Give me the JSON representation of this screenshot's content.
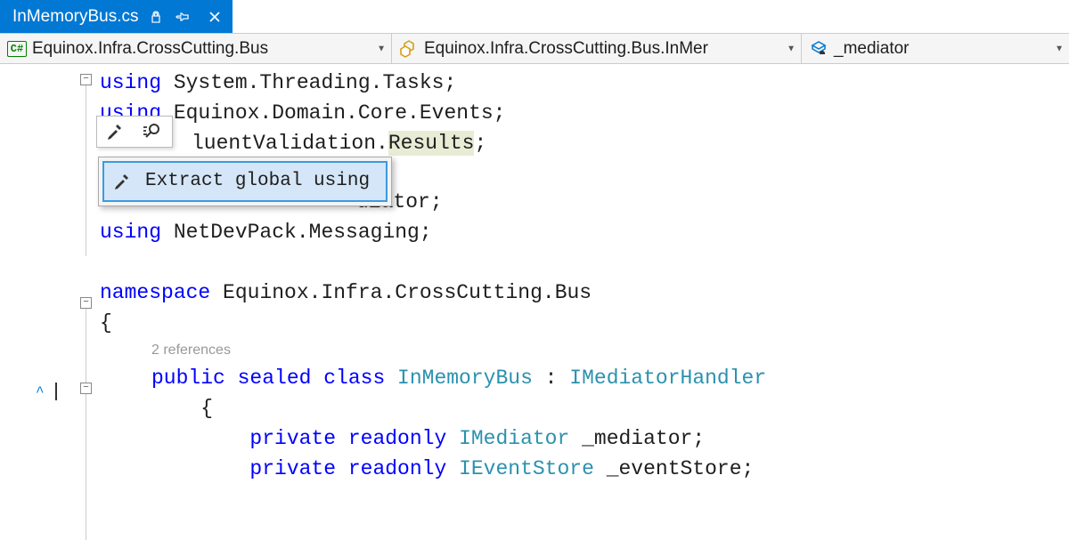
{
  "tab": {
    "title": "InMemoryBus.cs"
  },
  "nav": {
    "namespace": "Equinox.Infra.CrossCutting.Bus",
    "class": "Equinox.Infra.CrossCutting.Bus.InMer",
    "member": "_mediator"
  },
  "smartTag": {
    "action": "Extract global using"
  },
  "code": {
    "line1": {
      "kw": "using",
      "rest": " System.Threading.Tasks;"
    },
    "line2": {
      "kw": "using",
      "rest": " Equinox.Domain.Core.Events;"
    },
    "line3": {
      "pre": "luentValidation.",
      "hl": "Results",
      "post": ";"
    },
    "line4": {
      "rest": "diator;"
    },
    "line5": {
      "kw": "using",
      "rest": " NetDevPack.Messaging;"
    },
    "ns": {
      "kw": "namespace",
      "rest": " Equinox.Infra.CrossCutting.Bus"
    },
    "brace_open": "{",
    "codelens": "2 references",
    "cls": {
      "mods": "public sealed class ",
      "name": "InMemoryBus",
      "sep": " : ",
      "iface": "IMediatorHandler"
    },
    "brace_open2": "    {",
    "f1": {
      "mods": "        private readonly ",
      "type": "IMediator",
      "name": " _mediator;"
    },
    "f2": {
      "mods": "        private readonly ",
      "type": "IEventStore",
      "name": " _eventStore;"
    }
  }
}
